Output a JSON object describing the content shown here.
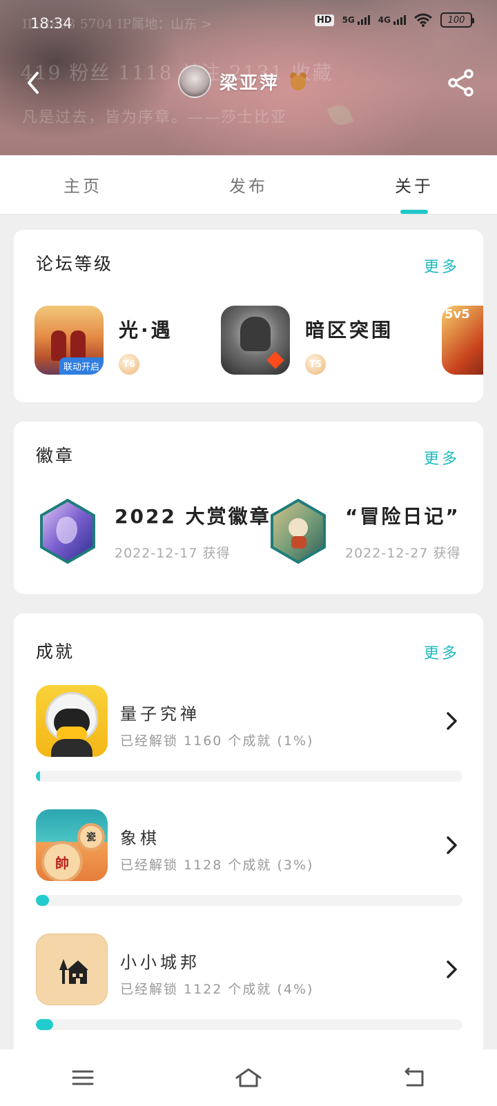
{
  "status_bar": {
    "time": "18:34",
    "hd_label": "HD",
    "network_1": "5G",
    "network_2": "4G",
    "battery": "100"
  },
  "header_bg": {
    "id_text": "ID:2893 5704    IP属地：山东 >",
    "stats_text": "419 粉丝   1118 关注   2131 收藏",
    "quote_text": "凡是过去，皆为序章。——莎士比亚"
  },
  "profile": {
    "name": "梁亚萍"
  },
  "tabs": [
    {
      "label": "主页",
      "active": false
    },
    {
      "label": "发布",
      "active": false
    },
    {
      "label": "关于",
      "active": true
    }
  ],
  "forum": {
    "title": "论坛等级",
    "more": "更多",
    "games": [
      {
        "name": "光·遇",
        "level": "T6",
        "tagline": "联动开启"
      },
      {
        "name": "暗区突围",
        "level": "T5"
      },
      {
        "name": "",
        "tag": "5v5"
      }
    ]
  },
  "badges": {
    "title": "徽章",
    "more": "更多",
    "items": [
      {
        "name": "2022 大赏徽章",
        "date": "2022-12-17 获得"
      },
      {
        "name": "“冒险日记”",
        "date": "2022-12-27 获得"
      }
    ]
  },
  "achievements": {
    "title": "成就",
    "more": "更多",
    "items": [
      {
        "name": "量子究禅",
        "desc": "已经解锁 1160 个成就 (1%)",
        "progress": 1
      },
      {
        "name": "象棋",
        "desc": "已经解锁 1128 个成就 (3%)",
        "progress": 3,
        "piece_1": "帥",
        "piece_2": "瓷"
      },
      {
        "name": "小小城邦",
        "desc": "已经解锁 1122 个成就 (4%)",
        "progress": 4
      }
    ]
  },
  "colors": {
    "accent": "#1fc8c8",
    "progress": "#22cccc",
    "more_link": "#1fbac0"
  }
}
